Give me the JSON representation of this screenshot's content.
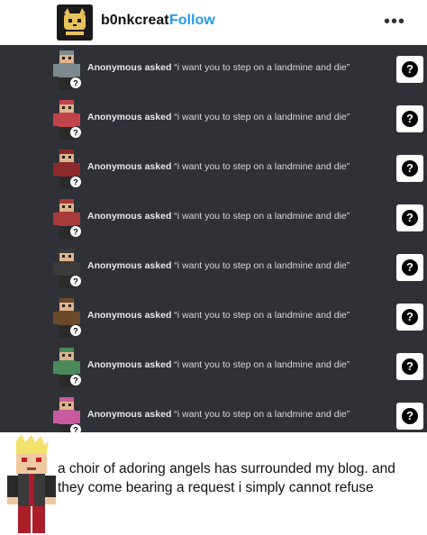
{
  "post": {
    "username": "b0nkcreat",
    "follow_label": "Follow",
    "more_icon": "more-horizontal-icon"
  },
  "asks": [
    {
      "asker": "Anonymous asked",
      "question": "“i want you to step on a landmine and die”",
      "skin_color": "#7c8a8f"
    },
    {
      "asker": "Anonymous asked",
      "question": "“i want you to step on a landmine and die”",
      "skin_color": "#c0444a"
    },
    {
      "asker": "Anonymous asked",
      "question": "“i want you to step on a landmine and die”",
      "skin_color": "#8b2a2a"
    },
    {
      "asker": "Anonymous asked",
      "question": "“i want you to step on a landmine and die”",
      "skin_color": "#a83a3a"
    },
    {
      "asker": "Anonymous asked",
      "question": "“i want you to step on a landmine and die”",
      "skin_color": "#3a3a3a"
    },
    {
      "asker": "Anonymous asked",
      "question": "“i want you to step on a landmine and die”",
      "skin_color": "#6b4a2a"
    },
    {
      "asker": "Anonymous asked",
      "question": "“i want you to step on a landmine and die”",
      "skin_color": "#4a8a5a"
    },
    {
      "asker": "Anonymous asked",
      "question": "“i want you to step on a landmine and die”",
      "skin_color": "#c85aa0"
    }
  ],
  "caption": "a choir of adoring angels has surrounded my blog. and they come bearing a request i simply cannot refuse",
  "colors": {
    "follow": "#1d9bf0",
    "panel_bg": "#2f3136"
  }
}
